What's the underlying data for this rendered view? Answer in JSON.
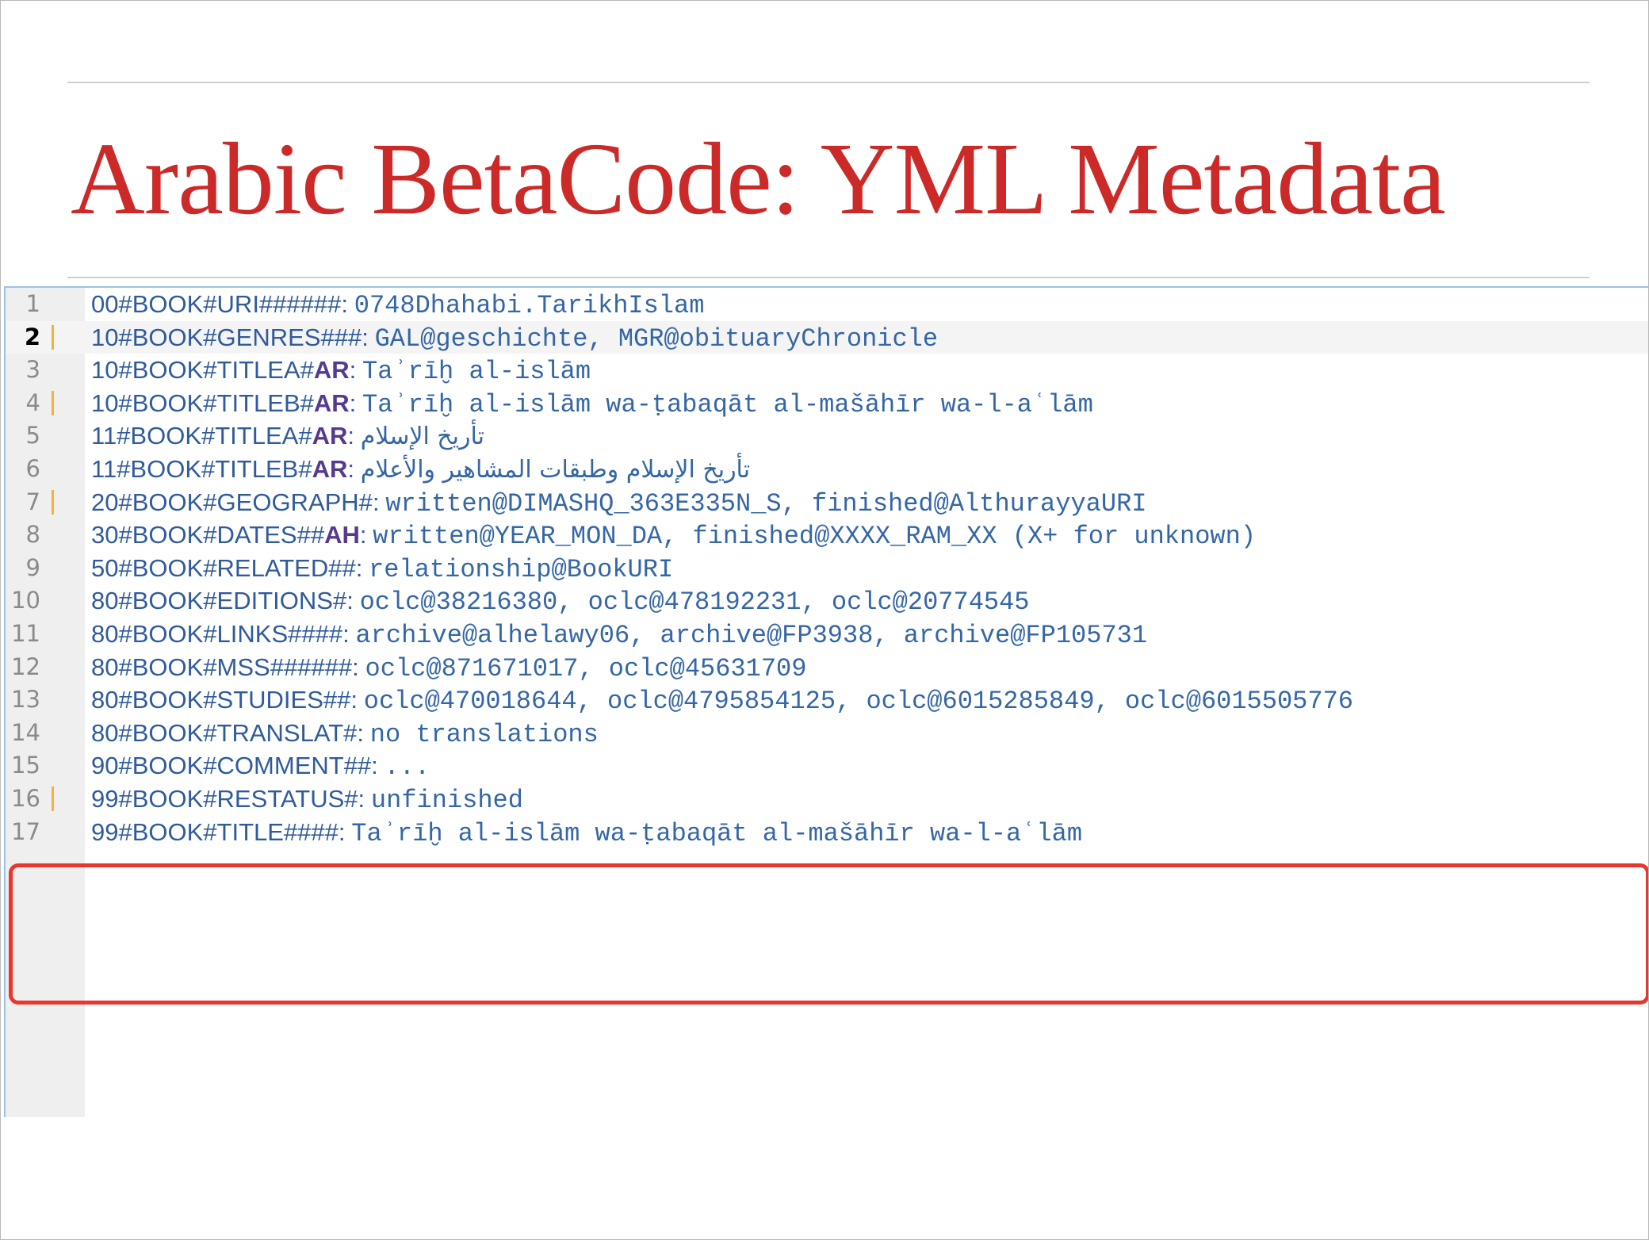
{
  "slide": {
    "title": "Arabic BetaCode: YML Metadata"
  },
  "editor": {
    "current_line": 2,
    "colors": {
      "key": "#2f5b9c",
      "key_suffix": "#553a90",
      "value": "#3466a6",
      "change_marker": "#f0b43c",
      "highlight_box": "#e8372c"
    },
    "lines": [
      {
        "num": "1",
        "key": "00#BOOK#URI######",
        "suffix": "",
        "sep": ":",
        "value": "0748Dhahabi.TarikhIslam",
        "changed": false
      },
      {
        "num": "2",
        "key": "10#BOOK#GENRES###",
        "suffix": "",
        "sep": ":",
        "value": "GAL@geschichte, MGR@obituaryChronicle",
        "changed": true
      },
      {
        "num": "3",
        "key": "10#BOOK#TITLEA#",
        "suffix": "AR",
        "sep": ":",
        "value": "Taʾrīḫ al-islām",
        "changed": false
      },
      {
        "num": "4",
        "key": "10#BOOK#TITLEB#",
        "suffix": "AR",
        "sep": ":",
        "value": "Taʾrīḫ al-islām wa-ṭabaqāt al-mašāhīr wa-l-aʿlām",
        "changed": true
      },
      {
        "num": "5",
        "key": "11#BOOK#TITLEA#",
        "suffix": "AR",
        "sep": ":",
        "value": "تأريخ الإسلام",
        "changed": false,
        "rtl": true
      },
      {
        "num": "6",
        "key": "11#BOOK#TITLEB#",
        "suffix": "AR",
        "sep": ":",
        "value": "تأريخ الإسلام وطبقات المشاهير والأعلام",
        "changed": false,
        "rtl": true
      },
      {
        "num": "7",
        "key": "20#BOOK#GEOGRAPH#",
        "suffix": "",
        "sep": ":",
        "value": "written@DIMASHQ_363E335N_S, finished@AlthurayyaURI",
        "changed": true
      },
      {
        "num": "8",
        "key": "30#BOOK#DATES##",
        "suffix": "AH",
        "sep": ":",
        "value": "written@YEAR_MON_DA, finished@XXXX_RAM_XX (X+ for unknown)",
        "changed": false
      },
      {
        "num": "9",
        "key": "50#BOOK#RELATED##",
        "suffix": "",
        "sep": ":",
        "value": "relationship@BookURI",
        "changed": false
      },
      {
        "num": "10",
        "key": "80#BOOK#EDITIONS#",
        "suffix": "",
        "sep": ":",
        "value": "oclc@38216380, oclc@478192231, oclc@20774545",
        "changed": false
      },
      {
        "num": "11",
        "key": "80#BOOK#LINKS####",
        "suffix": "",
        "sep": ":",
        "value": "archive@alhelawy06, archive@FP3938, archive@FP105731",
        "changed": false
      },
      {
        "num": "12",
        "key": "80#BOOK#MSS######",
        "suffix": "",
        "sep": ":",
        "value": "oclc@871671017, oclc@45631709",
        "changed": false
      },
      {
        "num": "13",
        "key": "80#BOOK#STUDIES##",
        "suffix": "",
        "sep": ":",
        "value": "oclc@470018644, oclc@4795854125, oclc@6015285849, oclc@6015505776",
        "changed": false
      },
      {
        "num": "14",
        "key": "80#BOOK#TRANSLAT#",
        "suffix": "",
        "sep": ":",
        "value": "no translations",
        "changed": false
      },
      {
        "num": "15",
        "key": "90#BOOK#COMMENT##",
        "suffix": "",
        "sep": ":",
        "value": "...",
        "changed": false
      },
      {
        "num": "16",
        "key": "99#BOOK#RESTATUS#",
        "suffix": "",
        "sep": ":",
        "value": "unfinished",
        "changed": true
      },
      {
        "num": "17",
        "key": "99#BOOK#TITLE####",
        "suffix": "",
        "sep": ":",
        "value": "Taʾrīḫ al-islām wa-ṭabaqāt al-mašāhīr wa-l-aʿlām",
        "changed": false
      }
    ]
  }
}
